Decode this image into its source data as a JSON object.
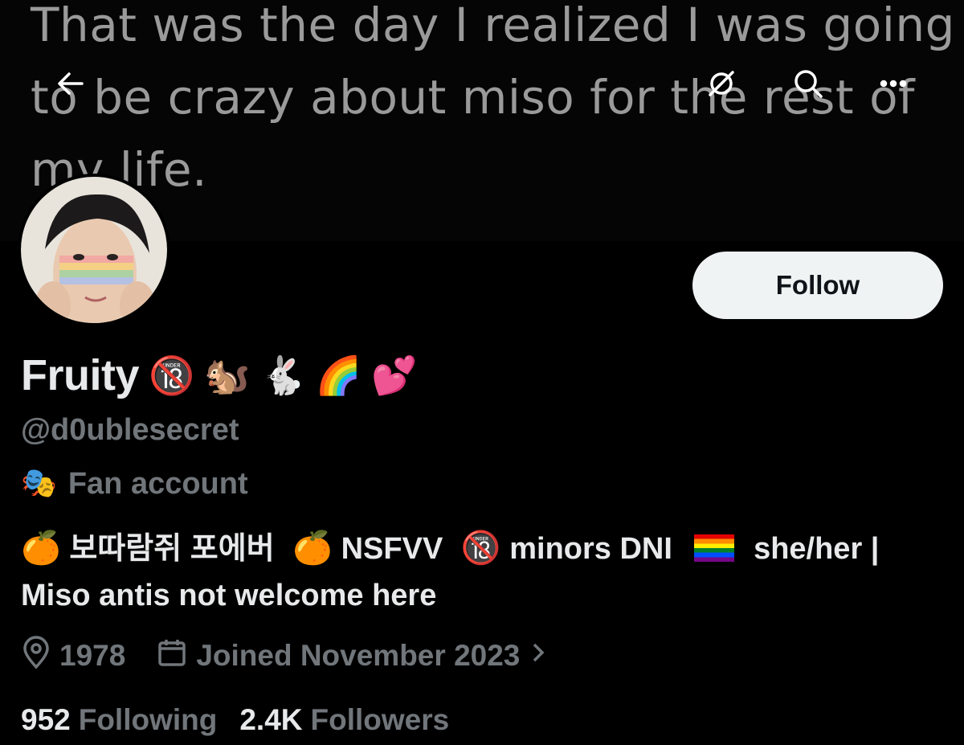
{
  "banner": {
    "text": "That was the day I realized I was going to be crazy about miso for the rest of my life."
  },
  "header": {
    "back_icon": "arrow-left-icon",
    "mute_icon": "eye-slash-icon",
    "search_icon": "search-icon",
    "more_icon": "ellipsis-icon"
  },
  "profile": {
    "display_name": "Fruity",
    "name_emojis": [
      "🔞",
      "🐿️",
      "🐇",
      "🌈",
      "💕"
    ],
    "handle": "@d0ublesecret",
    "category_icon": "🎭",
    "category": "Fan account",
    "follow_label": "Follow",
    "bio": {
      "part1_emoji": "🍊",
      "part1": "보따람쥐 포에버",
      "part2_emoji": "🍊",
      "part2": "NSFVV",
      "part3_emoji": "🔞",
      "part3": "minors DNI",
      "part4": "she/her |",
      "line2": "Miso antis not welcome here"
    },
    "location": "1978",
    "joined": "Joined November 2023",
    "following_count": "952",
    "following_label": "Following",
    "followers_count": "2.4K",
    "followers_label": "Followers"
  }
}
